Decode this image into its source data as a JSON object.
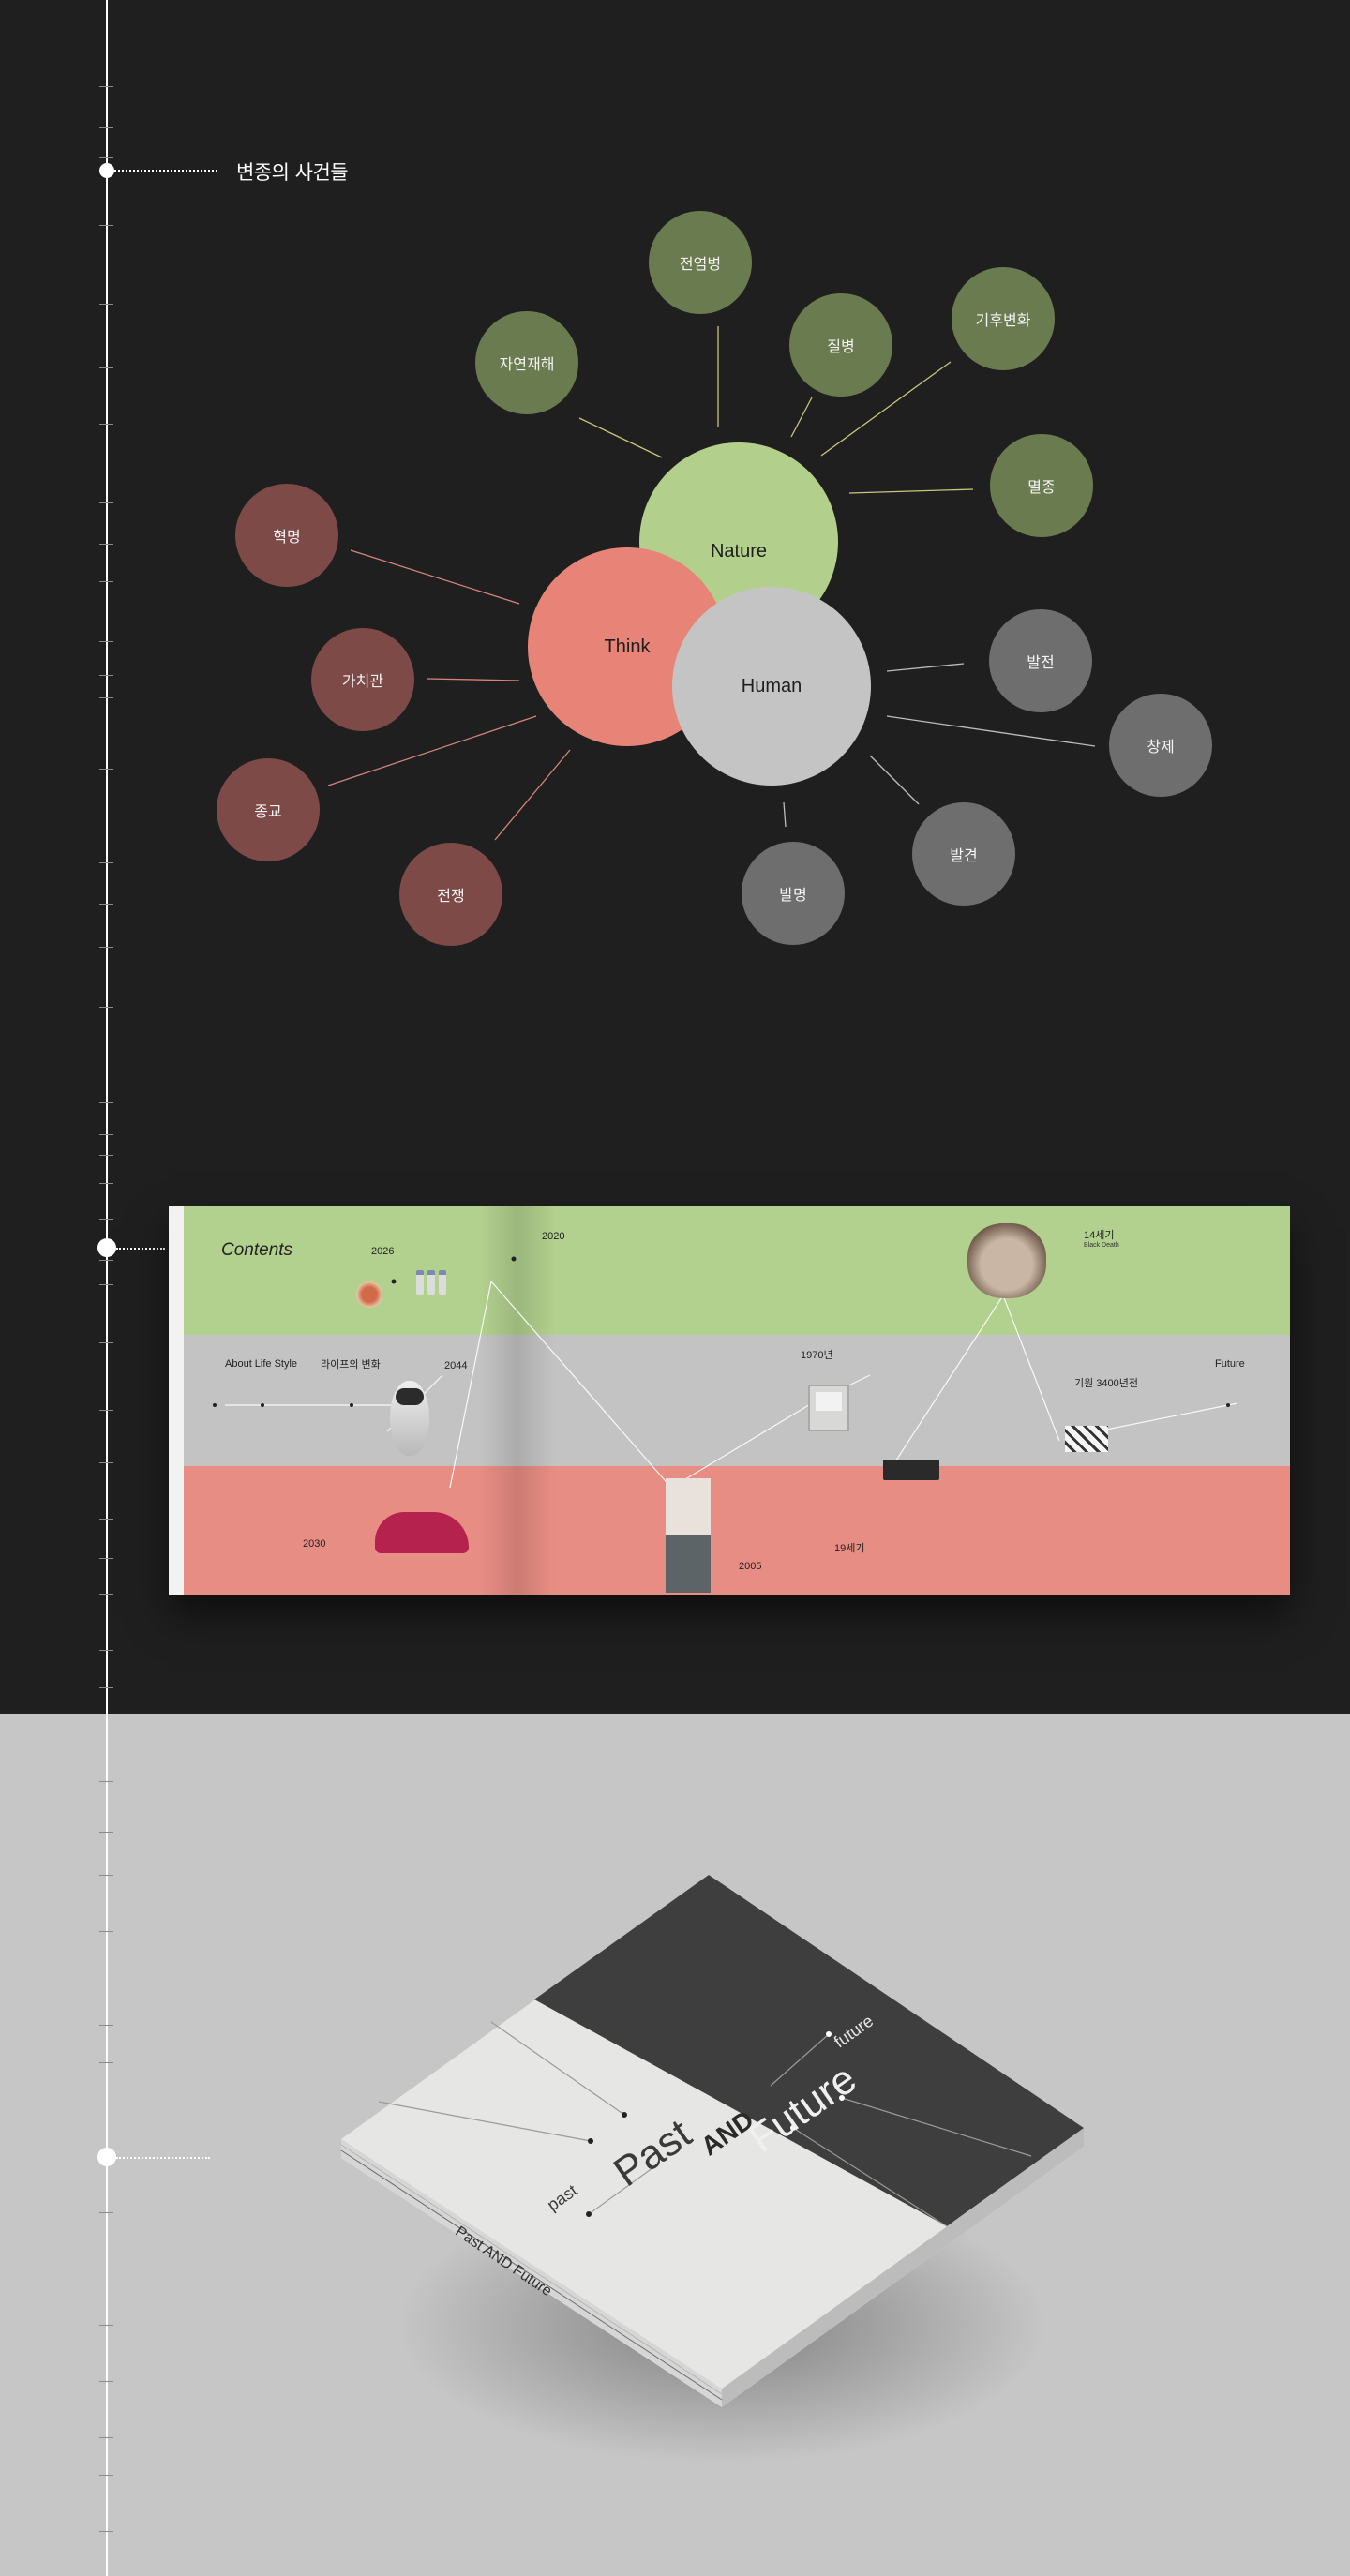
{
  "section_title": "변종의 사건들",
  "diagram": {
    "core": [
      {
        "label": "Nature",
        "color": "#b2d08b"
      },
      {
        "label": "Think",
        "color": "#e88378"
      },
      {
        "label": "Human",
        "color": "#c4c4c4"
      }
    ],
    "nature_events": [
      "전염병",
      "질병",
      "기후변화",
      "자연재해",
      "멸종"
    ],
    "think_events": [
      "혁명",
      "가치관",
      "종교",
      "전쟁"
    ],
    "human_events": [
      "발전",
      "창제",
      "발견",
      "발명"
    ]
  },
  "spread": {
    "contents_label": "Contents",
    "labels": {
      "about_life_style": "About Life Style",
      "lifestyle_change": "라이프의 변화",
      "future": "Future"
    },
    "years": {
      "y2026": "2026",
      "y2020": "2020",
      "y2044": "2044",
      "y2030": "2030",
      "y1970": "1970년",
      "y2005": "2005",
      "y14c": "14세기",
      "y19c": "19세기",
      "y3400": "기원 3400년전"
    },
    "captions": {
      "black_death": "Black Death"
    }
  },
  "book": {
    "past": "past",
    "future": "future",
    "title_past": "Past",
    "title_and": "AND",
    "title_future": "Future",
    "spine": "Past AND Future"
  }
}
